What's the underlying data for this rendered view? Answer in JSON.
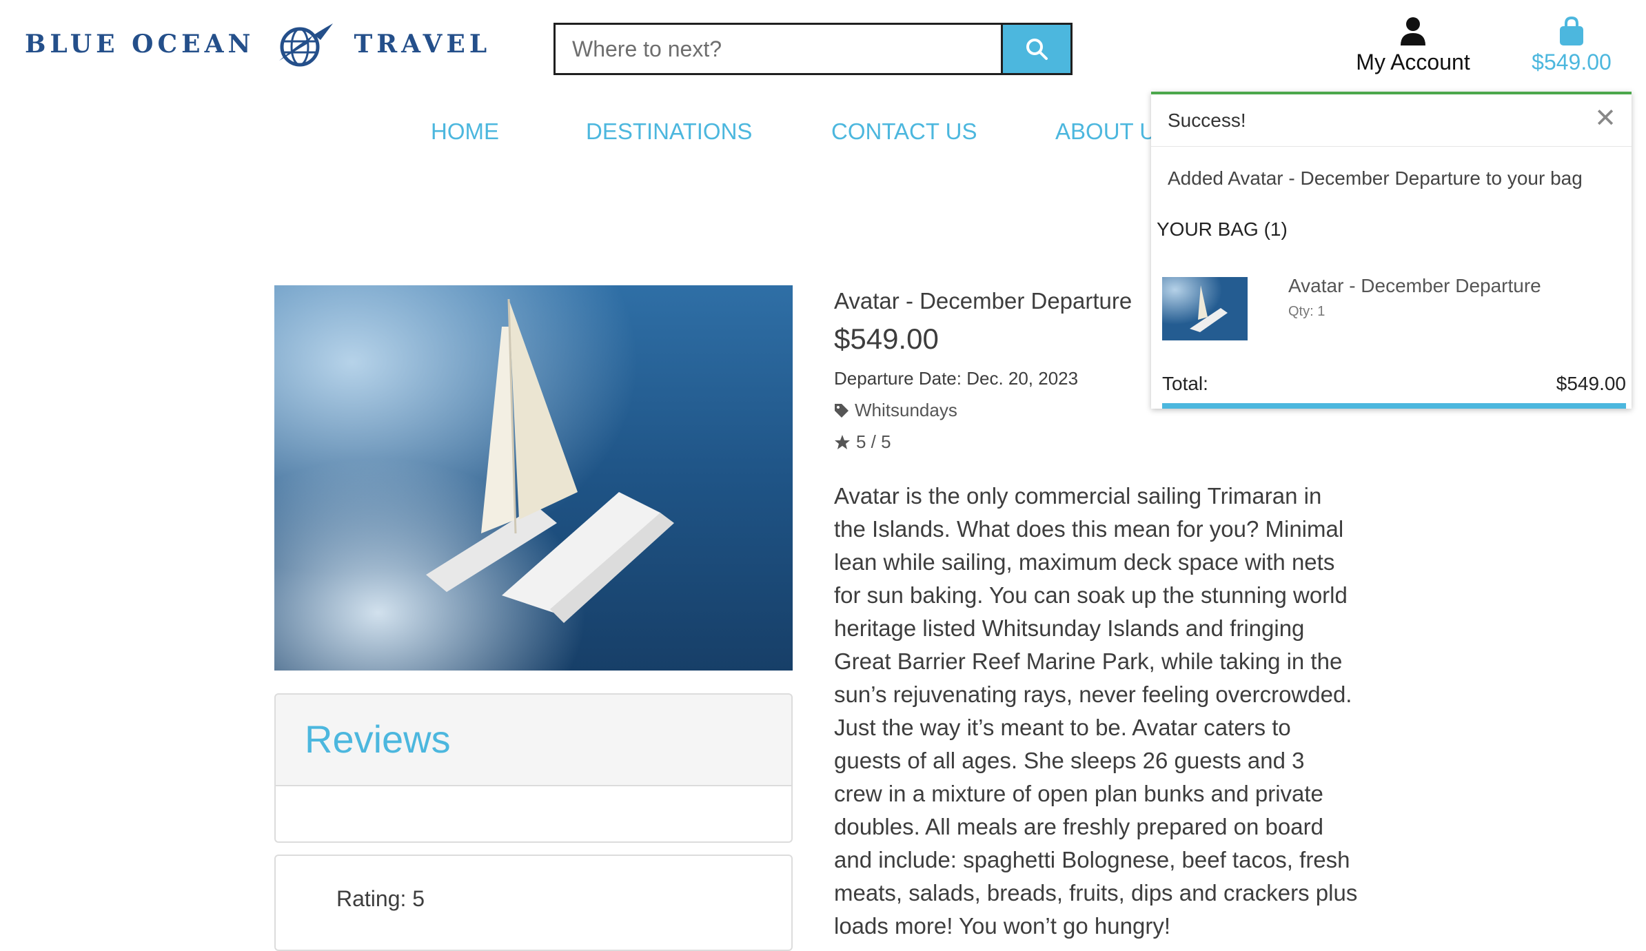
{
  "header": {
    "logo_left": "BLUE OCEAN",
    "logo_right": "TRAVEL",
    "logo_icon": "globe-plane-logo",
    "search_placeholder": "Where to next?",
    "search_icon": "search-icon",
    "account_label": "My Account",
    "account_icon": "user-icon",
    "bag_total": "$549.00",
    "bag_icon": "shopping-bag-icon"
  },
  "nav": {
    "items": [
      "HOME",
      "DESTINATIONS",
      "CONTACT US",
      "ABOUT U"
    ]
  },
  "product": {
    "image_alt": "catamaran-sailing-photo",
    "title": "Avatar - December Departure",
    "price": "$549.00",
    "departure": "Departure Date: Dec. 20, 2023",
    "category": "Whitsundays",
    "category_icon": "tag-icon",
    "rating": "5 / 5",
    "rating_icon": "star-icon",
    "description": "Avatar is the only commercial sailing Trimaran in the Islands. What does this mean for you? Minimal lean while sailing, maximum deck space with nets for sun baking. You can soak up the stunning world heritage listed Whitsunday Islands and fringing Great Barrier Reef Marine Park, while taking in the sun’s rejuvenating rays, never feeling overcrowded. Just the way it’s meant to be. Avatar caters to guests of all ages. She sleeps 26 guests and 3 crew in a mixture of open plan bunks and private doubles. All meals are freshly prepared on board and include: spaghetti Bolognese, beef tacos, fresh meats, salads, breads, fruits, dips and crackers plus loads more! You won’t go hungry!"
  },
  "reviews": {
    "heading": "Reviews",
    "rating_label": "Rating: 5"
  },
  "toast": {
    "title": "Success!",
    "close": "✕",
    "message": "Added Avatar - December Departure to your bag",
    "bag_heading": "YOUR BAG (1)",
    "item_name": "Avatar - December Departure",
    "item_qty": "Qty: 1",
    "total_label": "Total:",
    "total_value": "$549.00"
  },
  "colors": {
    "brand_blue": "#4cb7de",
    "logo_navy": "#244f8a",
    "success_green": "#4ca74c"
  }
}
